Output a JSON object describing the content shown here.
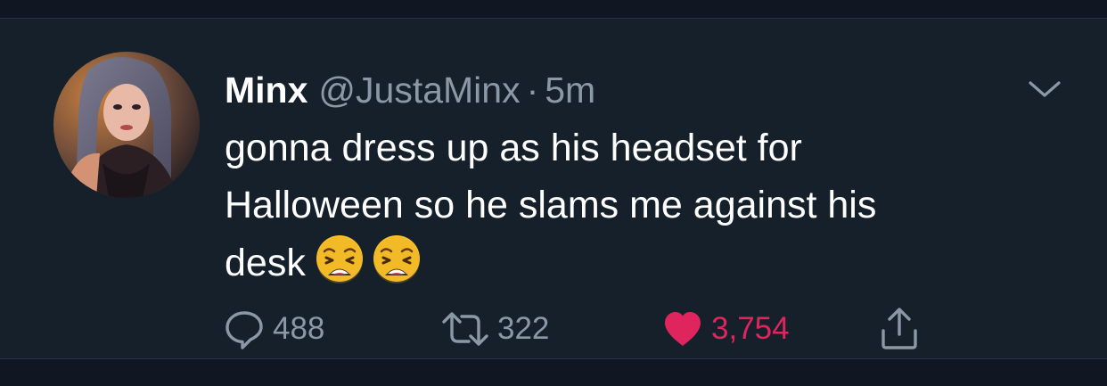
{
  "tweet": {
    "author": {
      "display_name": "Minx",
      "handle": "@JustaMinx",
      "separator": "·",
      "time": "5m"
    },
    "text_lines": [
      "gonna dress up as his headset for",
      "Halloween so he slams me against his",
      "desk"
    ],
    "emojis": [
      "weary-face-emoji",
      "weary-face-emoji"
    ],
    "actions": {
      "reply_count": "488",
      "retweet_count": "322",
      "like_count": "3,754",
      "liked": true
    },
    "menu_icon": "chevron-down-icon"
  },
  "colors": {
    "background": "#15202b",
    "text_primary": "#ffffff",
    "text_secondary": "#8b98a5",
    "like_accent": "#e0245e"
  }
}
